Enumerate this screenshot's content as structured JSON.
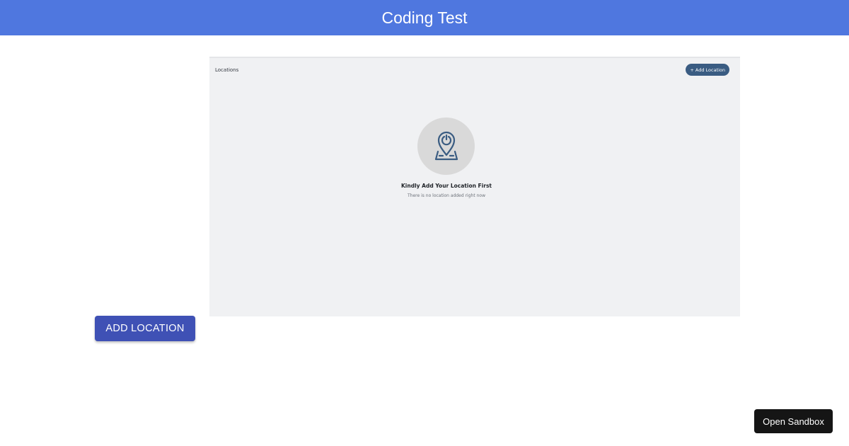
{
  "header": {
    "title": "Coding Test"
  },
  "preview": {
    "title": "Locations",
    "add_button_label": "+ Add Location",
    "empty_state": {
      "icon": "map-pin-icon",
      "heading": "Kindly Add Your Location First",
      "subtext": "There is no location added right now"
    }
  },
  "actions": {
    "add_location_label": "ADD LOCATION",
    "open_sandbox_label": "Open Sandbox"
  },
  "colors": {
    "header_bg": "#4f77df",
    "primary_button": "#3f51b5",
    "preview_bg": "#f0f1f3",
    "pill_button": "#3a5c82",
    "icon_stroke": "#3a5c82",
    "sandbox_button": "#151515"
  }
}
